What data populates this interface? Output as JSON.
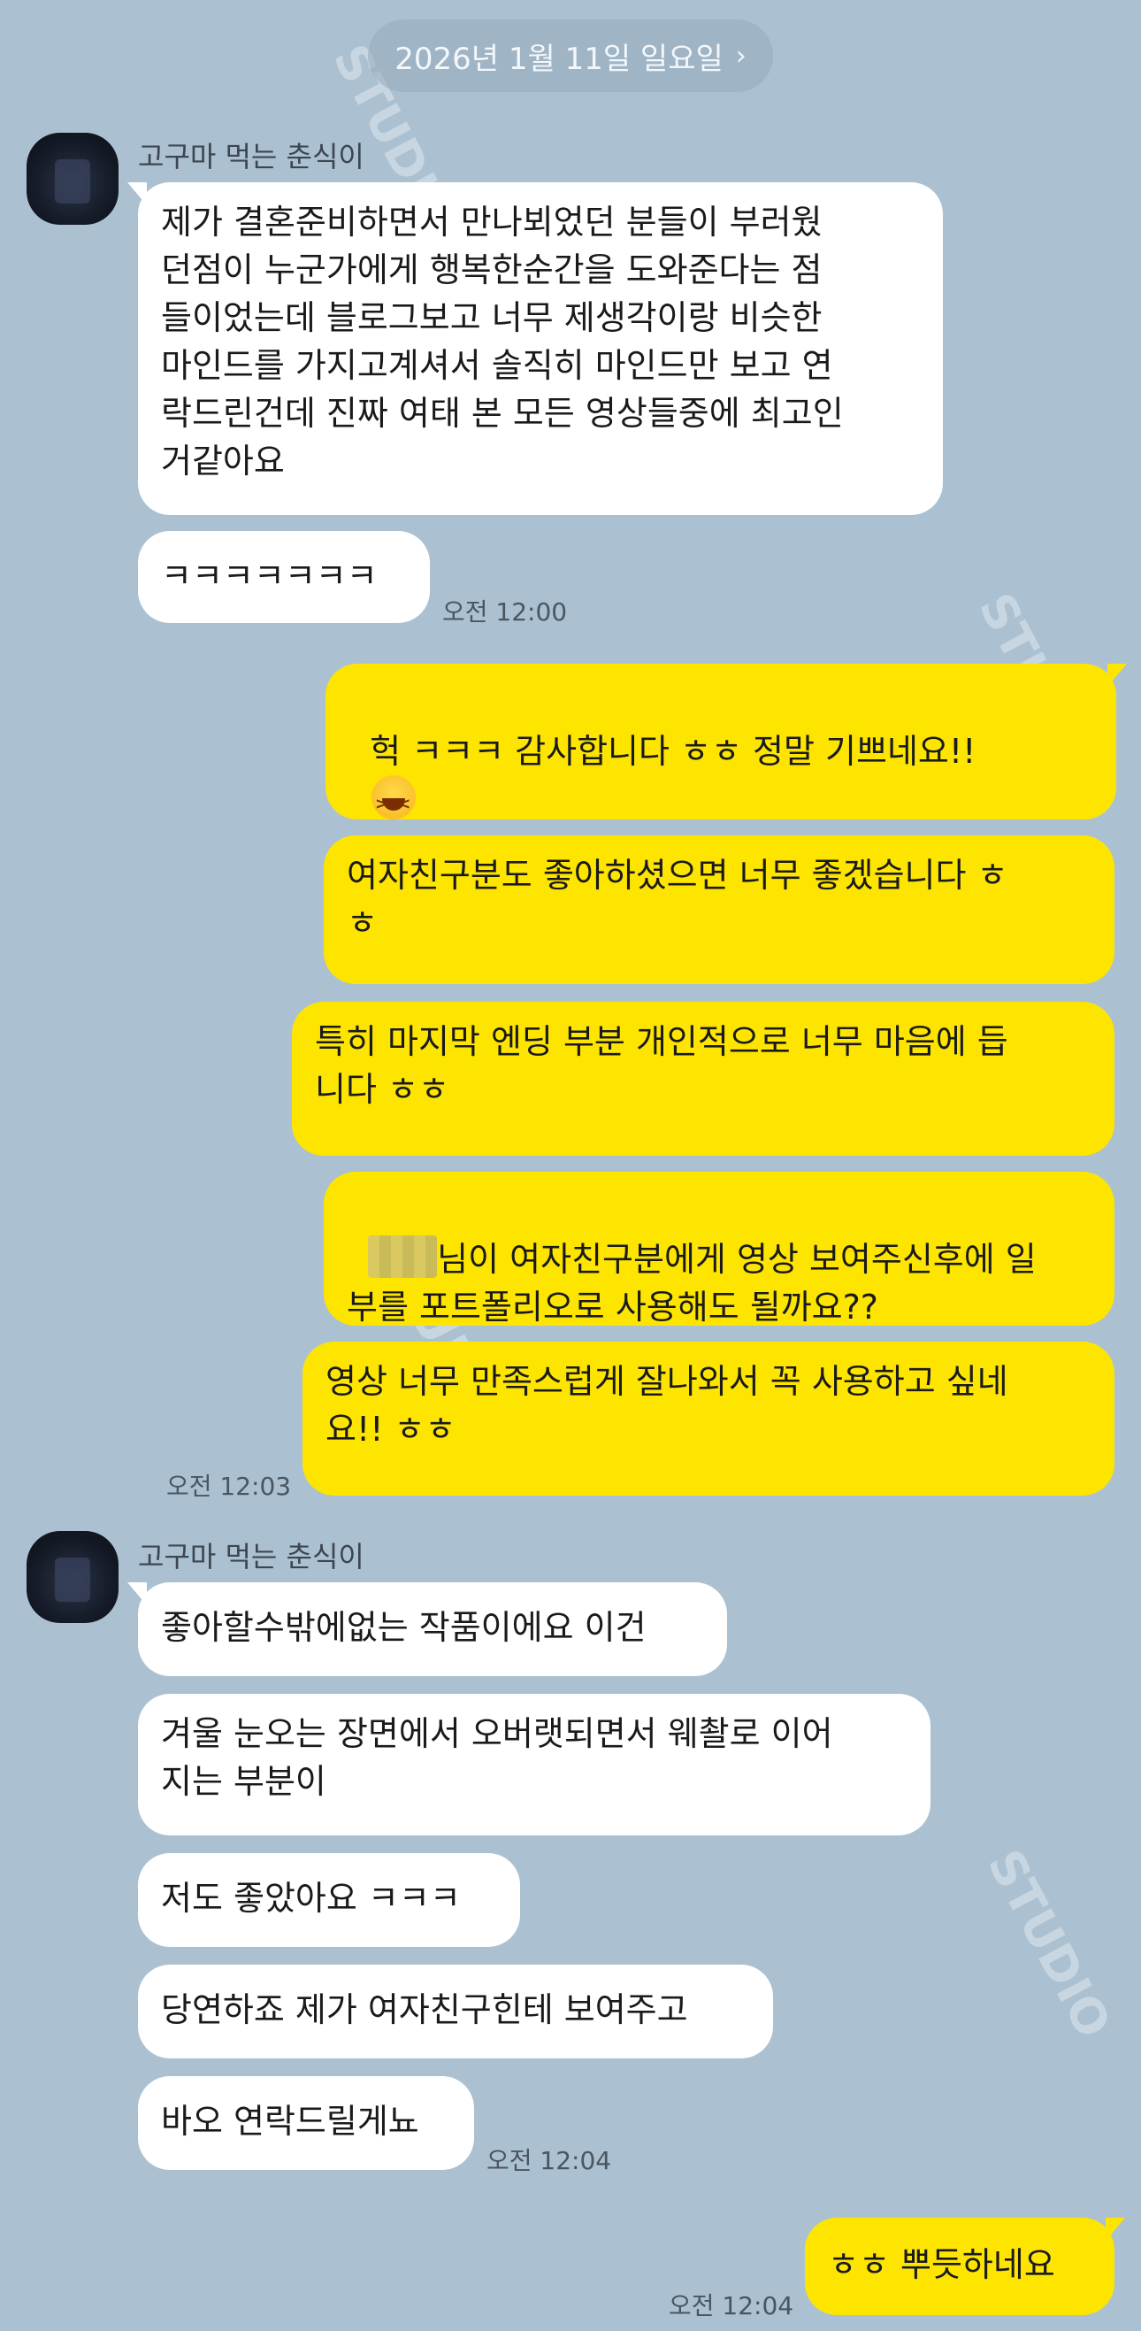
{
  "header": {
    "date": "2026년 1월 11일 일요일",
    "chevron_icon": "chevron-right-icon"
  },
  "colors": {
    "background": "#abc1d1",
    "incoming": "#ffffff",
    "outgoing": "#fee500"
  },
  "watermark": {
    "text": "STUDIO"
  },
  "messages": {
    "group1": {
      "sender": "고구마 먹는 춘식이",
      "m1": "제가 결혼준비하면서 만나뵈었던 분들이 부러웠\n던점이 누군가에게 행복한순간을 도와준다는 점\n들이었는데 블로그보고 너무 제생각이랑 비슷한\n마인드를 가지고계셔서 솔직히 마인드만 보고 연\n락드린건데 진짜 여태 본 모든 영상들중에 최고인\n거같아요",
      "m2": "ㅋㅋㅋㅋㅋㅋㅋ",
      "time": "오전 12:00"
    },
    "group2": {
      "m1": "헉 ㅋㅋㅋ 감사합니다 ㅎㅎ 정말 기쁘네요!!",
      "m2": "여자친구분도 좋아하셨으면 너무 좋겠습니다 ㅎ\nㅎ",
      "m3": "특히 마지막 엔딩 부분 개인적으로 너무 마음에 듭\n니다 ㅎㅎ",
      "m4a": "님이 여자친구분에게 영상 보여주신후에 일",
      "m4b": "부를 포트폴리오로 사용해도 될까요??",
      "m5": "영상 너무 만족스럽게 잘나와서 꼭 사용하고 싶네\n요!! ㅎㅎ",
      "time": "오전 12:03"
    },
    "group3": {
      "sender": "고구마 먹는 춘식이",
      "m1": "좋아할수밖에없는 작품이에요 이건",
      "m2": "겨울 눈오는 장면에서 오버랫되면서 웨촬로 이어\n지는 부분이",
      "m3": "저도 좋았아요 ㅋㅋㅋ",
      "m4": "당연하죠 제가 여자친구힌테 보여주고",
      "m5": "바오 연락드릴게뇨",
      "time": "오전 12:04"
    },
    "group4": {
      "m1": "ㅎㅎ 뿌듯하네요",
      "time": "오전 12:04"
    }
  }
}
